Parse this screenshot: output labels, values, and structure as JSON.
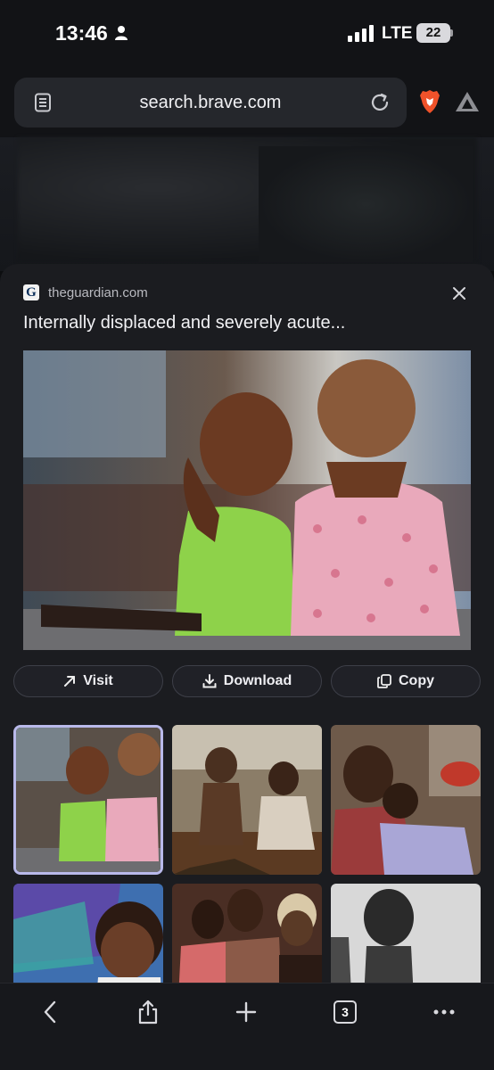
{
  "status_bar": {
    "time": "13:46",
    "network": "LTE",
    "battery": "22"
  },
  "address_bar": {
    "url": "search.brave.com"
  },
  "image_viewer": {
    "source": "theguardian.com",
    "favicon_letter": "G",
    "title": "Internally displaced and severely acute...",
    "actions": {
      "visit": "Visit",
      "download": "Download",
      "copy": "Copy"
    }
  },
  "bottom_toolbar": {
    "tab_count": "3"
  },
  "colors": {
    "sheet_background": "#1b1c20",
    "selected_thumb_border": "#b9b9ea",
    "brave_orange": "#f0522a"
  }
}
